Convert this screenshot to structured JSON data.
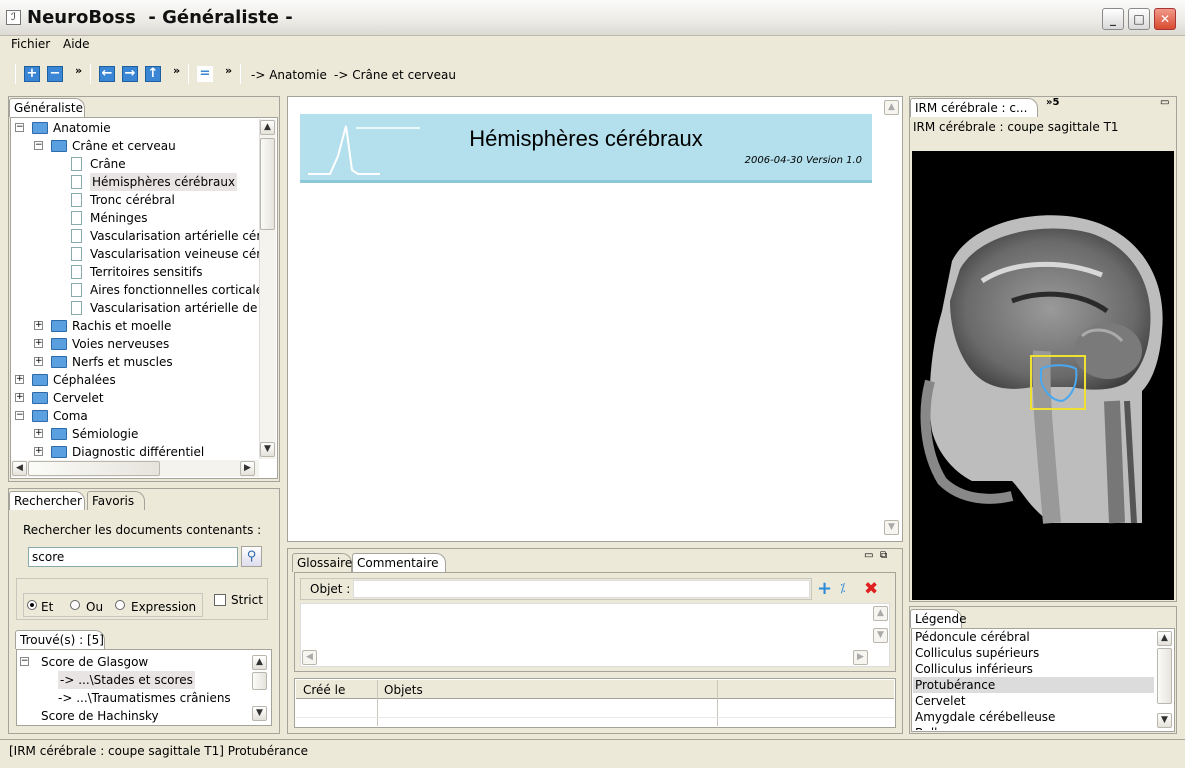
{
  "window": {
    "title": "NeuroBoss  - Généraliste -",
    "minimize": "_",
    "maximize": "□",
    "close": "✕"
  },
  "menu": {
    "file": "Fichier",
    "help": "Aide"
  },
  "toolbar": {
    "chev1": "»",
    "chev2": "»",
    "chev3": "»",
    "breadcrumb1": "-> Anatomie",
    "breadcrumb2": "-> Crâne et cerveau",
    "icons": [
      "expand-all-icon",
      "collapse-all-icon",
      "back-icon",
      "forward-icon",
      "up-icon",
      "sync-icon"
    ]
  },
  "left_panel": {
    "tab": "Généraliste",
    "tree": [
      {
        "label": "Anatomie",
        "type": "folder-open",
        "level": 0,
        "expander": "−"
      },
      {
        "label": "Crâne et cerveau",
        "type": "folder-open",
        "level": 1,
        "expander": "−"
      },
      {
        "label": "Crâne",
        "type": "doc",
        "level": 2
      },
      {
        "label": "Hémisphères cérébraux",
        "type": "doc",
        "level": 2,
        "selected": true
      },
      {
        "label": "Tronc cérébral",
        "type": "doc",
        "level": 2
      },
      {
        "label": "Méninges",
        "type": "doc",
        "level": 2
      },
      {
        "label": "Vascularisation artérielle céré",
        "type": "doc",
        "level": 2
      },
      {
        "label": "Vascularisation veineuse céré",
        "type": "doc",
        "level": 2
      },
      {
        "label": "Territoires sensitifs",
        "type": "doc",
        "level": 2
      },
      {
        "label": "Aires fonctionnelles corticales",
        "type": "doc",
        "level": 2
      },
      {
        "label": "Vascularisation artérielle de l'",
        "type": "doc",
        "level": 2
      },
      {
        "label": "Rachis et moelle",
        "type": "folder",
        "level": 1,
        "expander": "+"
      },
      {
        "label": "Voies nerveuses",
        "type": "folder",
        "level": 1,
        "expander": "+"
      },
      {
        "label": "Nerfs et muscles",
        "type": "folder",
        "level": 1,
        "expander": "+"
      },
      {
        "label": "Céphalées",
        "type": "folder",
        "level": 0,
        "expander": "+"
      },
      {
        "label": "Cervelet",
        "type": "folder",
        "level": 0,
        "expander": "+"
      },
      {
        "label": "Coma",
        "type": "folder-open",
        "level": 0,
        "expander": "−"
      },
      {
        "label": "Sémiologie",
        "type": "folder",
        "level": 1,
        "expander": "+"
      },
      {
        "label": "Diagnostic différentiel",
        "type": "folder",
        "level": 1,
        "expander": "+"
      }
    ]
  },
  "search_panel": {
    "tab_search": "Rechercher",
    "tab_favorites": "Favoris",
    "prompt": "Rechercher les documents contenants :",
    "query": "score",
    "opt_and": "Et",
    "opt_or": "Ou",
    "opt_expr": "Expression",
    "strict": "Strict",
    "found_tab": "Trouvé(s) : [5]",
    "results": [
      {
        "label": "Score de Glasgow",
        "level": 0,
        "expander": "−"
      },
      {
        "label": "-> ...\\Stades et scores",
        "level": 1,
        "selected": true
      },
      {
        "label": "-> ...\\Traumatismes crâniens",
        "level": 1
      },
      {
        "label": "Score de Hachinsky",
        "level": 0
      }
    ]
  },
  "document": {
    "title": "Hémisphères cérébraux",
    "meta": "2006-04-30 Version 1.0"
  },
  "comment_panel": {
    "tab_glossary": "Glossaire",
    "tab_comment": "Commentaire",
    "object_label": "Objet :",
    "object_value": "",
    "col_created": "Créé le",
    "col_objects": "Objets"
  },
  "image_panel": {
    "tab": "IRM cérébrale : c...",
    "overflow": "»5",
    "caption": "IRM cérébrale : coupe sagittale T1"
  },
  "legend_panel": {
    "tab": "Légende",
    "items": [
      "Pédoncule cérébral",
      "Colliculus supérieurs",
      "Colliculus inférieurs",
      "Protubérance",
      "Cervelet",
      "Amygdale cérébelleuse",
      "Bulbe"
    ],
    "selected_index": 3
  },
  "status": {
    "text": "[IRM cérébrale : coupe sagittale T1] Protubérance"
  },
  "colors": {
    "accent": "#3a86d4",
    "header_band": "#b3e0ec",
    "selection": "#e8e4e4",
    "highlight_box": "#f0e030",
    "outline": "#4aa8f0"
  }
}
